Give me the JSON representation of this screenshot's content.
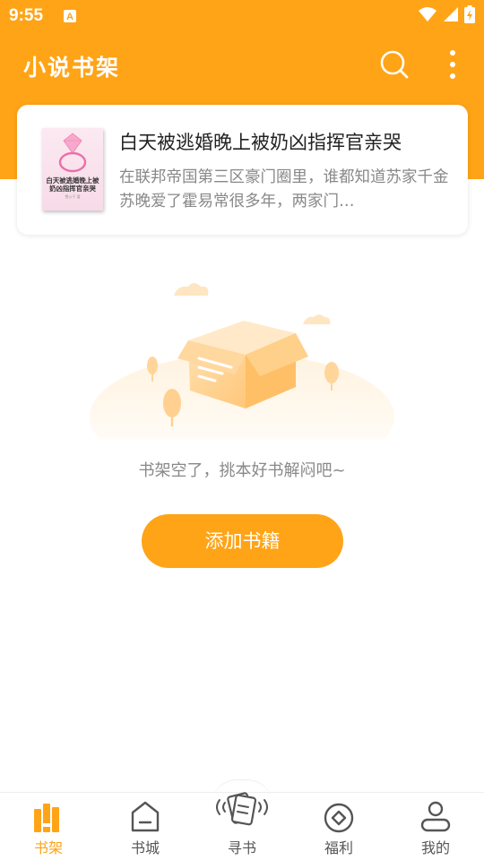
{
  "status": {
    "time": "9:55"
  },
  "app_bar": {
    "title": "小说书架"
  },
  "recommend": {
    "title": "白天被逃婚晚上被奶凶指挥官亲哭",
    "description": "在联邦帝国第三区豪门圈里，谁都知道苏家千金苏晚爱了霍易常很多年，两家门…",
    "cover_title": "白天被逃婚晚上被奶凶指挥官亲哭",
    "cover_author": "雪公子 著"
  },
  "empty": {
    "message": "书架空了，挑本好书解闷吧~",
    "add_button": "添加书籍"
  },
  "nav": {
    "items": [
      {
        "label": "书架",
        "icon": "bookshelf-icon",
        "active": true
      },
      {
        "label": "书城",
        "icon": "store-icon",
        "active": false
      },
      {
        "label": "寻书",
        "icon": "find-book-icon",
        "active": false
      },
      {
        "label": "福利",
        "icon": "coin-icon",
        "active": false
      },
      {
        "label": "我的",
        "icon": "profile-icon",
        "active": false
      }
    ]
  },
  "colors": {
    "accent": "#FFA417",
    "text_dark": "#222222",
    "text_muted": "#888888"
  }
}
